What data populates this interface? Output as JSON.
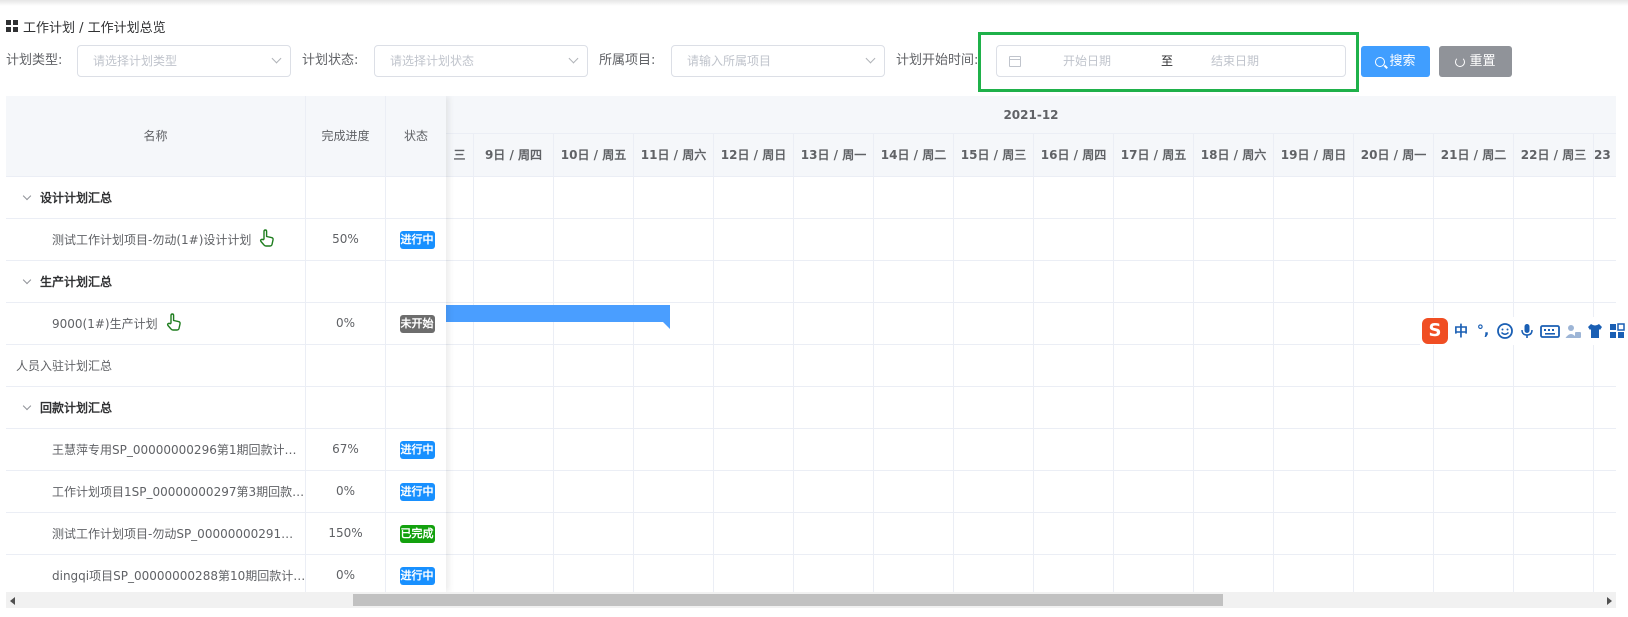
{
  "breadcrumb": {
    "text": "工作计划 / 工作计划总览"
  },
  "filters": {
    "plan_type_label": "计划类型:",
    "plan_type_placeholder": "请选择计划类型",
    "plan_status_label": "计划状态:",
    "plan_status_placeholder": "请选择计划状态",
    "project_label": "所属项目:",
    "project_placeholder": "请输入所属项目",
    "start_time_label": "计划开始时间:",
    "start_date_placeholder": "开始日期",
    "range_separator": "至",
    "end_date_placeholder": "结束日期",
    "search_label": "搜索",
    "reset_label": "重置"
  },
  "table": {
    "headers": {
      "name": "名称",
      "progress": "完成进度",
      "status": "状态"
    },
    "rows": [
      {
        "type": "group",
        "name": "设计计划汇总",
        "progress": "",
        "status": ""
      },
      {
        "type": "child",
        "name": "测试工作计划项目-勿动(1#)设计计划",
        "progress": "50%",
        "status": "进行中",
        "hand": true
      },
      {
        "type": "group",
        "name": "生产计划汇总",
        "progress": "",
        "status": ""
      },
      {
        "type": "child",
        "name": "9000(1#)生产计划",
        "progress": "0%",
        "status": "未开始",
        "hand": true
      },
      {
        "type": "plain",
        "name": "人员入驻计划汇总",
        "progress": "",
        "status": ""
      },
      {
        "type": "group",
        "name": "回款计划汇总",
        "progress": "",
        "status": ""
      },
      {
        "type": "child",
        "name": "王慧萍专用SP_00000000296第1期回款计…",
        "progress": "67%",
        "status": "进行中"
      },
      {
        "type": "child",
        "name": "工作计划项目1SP_00000000297第3期回款…",
        "progress": "0%",
        "status": "进行中"
      },
      {
        "type": "child",
        "name": "测试工作计划项目-勿动SP_00000000291…",
        "progress": "150%",
        "status": "已完成"
      },
      {
        "type": "child",
        "name": "dingqi项目SP_00000000288第10期回款计…",
        "progress": "0%",
        "status": "进行中"
      }
    ]
  },
  "timeline": {
    "month": "2021-12",
    "days": [
      "三",
      "9日 / 周四",
      "10日 / 周五",
      "11日 / 周六",
      "12日 / 周日",
      "13日 / 周一",
      "14日 / 周二",
      "15日 / 周三",
      "16日 / 周四",
      "17日 / 周五",
      "18日 / 周六",
      "19日 / 周日",
      "20日 / 周一",
      "21日 / 周二",
      "22日 / 周三",
      "23"
    ]
  },
  "ime": {
    "logo": "S",
    "mode": "中",
    "punct": "°,"
  },
  "colors": {
    "primary": "#409eff",
    "info": "#909399",
    "highlight": "#1fb14a",
    "in_progress": "#1890ff",
    "not_started": "#6d6d6d",
    "done": "#13a10e"
  }
}
